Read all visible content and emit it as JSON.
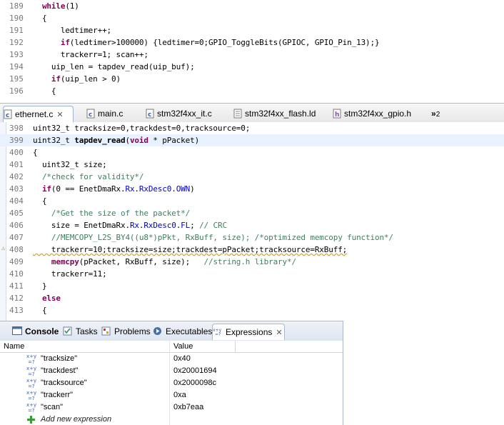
{
  "top_editor": {
    "lines": [
      {
        "no": "189",
        "tokens": [
          {
            "t": "  "
          },
          {
            "t": "while",
            "c": "kw"
          },
          {
            "t": "(1)"
          }
        ]
      },
      {
        "no": "190",
        "tokens": [
          {
            "t": "  {"
          }
        ]
      },
      {
        "no": "191",
        "tokens": [
          {
            "t": "      ledtimer++;"
          }
        ]
      },
      {
        "no": "192",
        "tokens": [
          {
            "t": "      "
          },
          {
            "t": "if",
            "c": "kw"
          },
          {
            "t": "(ledtimer>100000) {ledtimer=0;GPIO_ToggleBits(GPIOC, GPIO_Pin_13);}"
          }
        ]
      },
      {
        "no": "193",
        "tokens": [
          {
            "t": "      trackerr=1; scan++;"
          }
        ]
      },
      {
        "no": "194",
        "tokens": [
          {
            "t": "    uip_len = tapdev_read(uip_buf);"
          }
        ]
      },
      {
        "no": "195",
        "tokens": [
          {
            "t": "    "
          },
          {
            "t": "if",
            "c": "kw"
          },
          {
            "t": "(uip_len > 0)"
          }
        ]
      },
      {
        "no": "196",
        "tokens": [
          {
            "t": "    {"
          }
        ]
      }
    ]
  },
  "editor_tabs": [
    {
      "label": "ethernet.c",
      "active": true
    },
    {
      "label": "main.c",
      "active": false
    },
    {
      "label": "stm32f4xx_it.c",
      "active": false
    },
    {
      "label": "stm32f4xx_flash.ld",
      "active": false
    },
    {
      "label": "stm32f4xx_gpio.h",
      "active": false
    }
  ],
  "editor_tab_overflow": {
    "glyph": "»",
    "count": "2"
  },
  "bottom_editor": {
    "lines": [
      {
        "no": "398",
        "tokens": [
          {
            "t": "uint32_t tracksize=0,trackdest=0,tracksource=0;"
          }
        ]
      },
      {
        "no": "399",
        "current": true,
        "tokens": [
          {
            "t": "uint32_t "
          },
          {
            "t": "tapdev_read",
            "c": "bold"
          },
          {
            "t": "("
          },
          {
            "t": "void",
            "c": "kw"
          },
          {
            "t": " * pPacket)"
          }
        ]
      },
      {
        "no": "400",
        "tokens": [
          {
            "t": "{"
          }
        ]
      },
      {
        "no": "401",
        "tokens": [
          {
            "t": "  uint32_t size;"
          }
        ]
      },
      {
        "no": "402",
        "tokens": [
          {
            "t": "  "
          },
          {
            "t": "/*check for validity*/",
            "c": "cm"
          }
        ]
      },
      {
        "no": "403",
        "tokens": [
          {
            "t": "  "
          },
          {
            "t": "if",
            "c": "kw"
          },
          {
            "t": "(0 == EnetDmaRx."
          },
          {
            "t": "Rx",
            "c": "fld"
          },
          {
            "t": "."
          },
          {
            "t": "RxDesc0",
            "c": "fld"
          },
          {
            "t": "."
          },
          {
            "t": "OWN",
            "c": "fld"
          },
          {
            "t": ")"
          }
        ]
      },
      {
        "no": "404",
        "tokens": [
          {
            "t": "  {"
          }
        ]
      },
      {
        "no": "405",
        "tokens": [
          {
            "t": "    "
          },
          {
            "t": "/*Get the size of the packet*/",
            "c": "cm"
          }
        ]
      },
      {
        "no": "406",
        "tokens": [
          {
            "t": "    size = EnetDmaRx."
          },
          {
            "t": "Rx",
            "c": "fld"
          },
          {
            "t": "."
          },
          {
            "t": "RxDesc0",
            "c": "fld"
          },
          {
            "t": "."
          },
          {
            "t": "FL",
            "c": "fld"
          },
          {
            "t": "; "
          },
          {
            "t": "// CRC",
            "c": "cm"
          }
        ]
      },
      {
        "no": "407",
        "tokens": [
          {
            "t": "    "
          },
          {
            "t": "//MEMCOPY_L2S_BY4((u8*)pPkt, RxBuff, size); /*optimized memcopy function*/",
            "c": "cm"
          }
        ]
      },
      {
        "no": "408",
        "warning": true,
        "tokens": [
          {
            "t": "    trackerr=10;tracksize=size;trackdest=pPacket;tracksource=RxBuff;",
            "c": "wavy"
          }
        ]
      },
      {
        "no": "409",
        "tokens": [
          {
            "t": "    "
          },
          {
            "t": "memcpy",
            "c": "kw"
          },
          {
            "t": "(pPacket, RxBuff, size);   "
          },
          {
            "t": "//string.h library*/",
            "c": "cm"
          }
        ]
      },
      {
        "no": "410",
        "tokens": [
          {
            "t": "    trackerr=11;"
          }
        ]
      },
      {
        "no": "411",
        "tokens": [
          {
            "t": "  }"
          }
        ]
      },
      {
        "no": "412",
        "tokens": [
          {
            "t": "  "
          },
          {
            "t": "else",
            "c": "kw"
          }
        ]
      },
      {
        "no": "413",
        "tokens": [
          {
            "t": "  {"
          }
        ]
      }
    ]
  },
  "view_tabs": [
    {
      "label": "Console",
      "active": false,
      "icon": "console-icon"
    },
    {
      "label": "Tasks",
      "active": false,
      "icon": "tasks-icon"
    },
    {
      "label": "Problems",
      "active": false,
      "icon": "problems-icon"
    },
    {
      "label": "Executables",
      "active": false,
      "icon": "executables-icon"
    },
    {
      "label": "Expressions",
      "active": true,
      "icon": "expressions-icon"
    }
  ],
  "expressions": {
    "columns": [
      "Name",
      "Value"
    ],
    "rows": [
      {
        "name": "\"tracksize\"",
        "value": "0x40"
      },
      {
        "name": "\"trackdest\"",
        "value": "0x20001694"
      },
      {
        "name": "\"tracksource\"",
        "value": "0x2000098c"
      },
      {
        "name": "\"trackerr\"",
        "value": "0xa"
      },
      {
        "name": "\"scan\"",
        "value": "0xb7eaa"
      }
    ],
    "add_label": "Add new expression"
  },
  "colors": {
    "keyword": "#7f0055",
    "comment": "#3f7f5f",
    "field": "#0000c0",
    "current_line": "#e8f2fe"
  }
}
